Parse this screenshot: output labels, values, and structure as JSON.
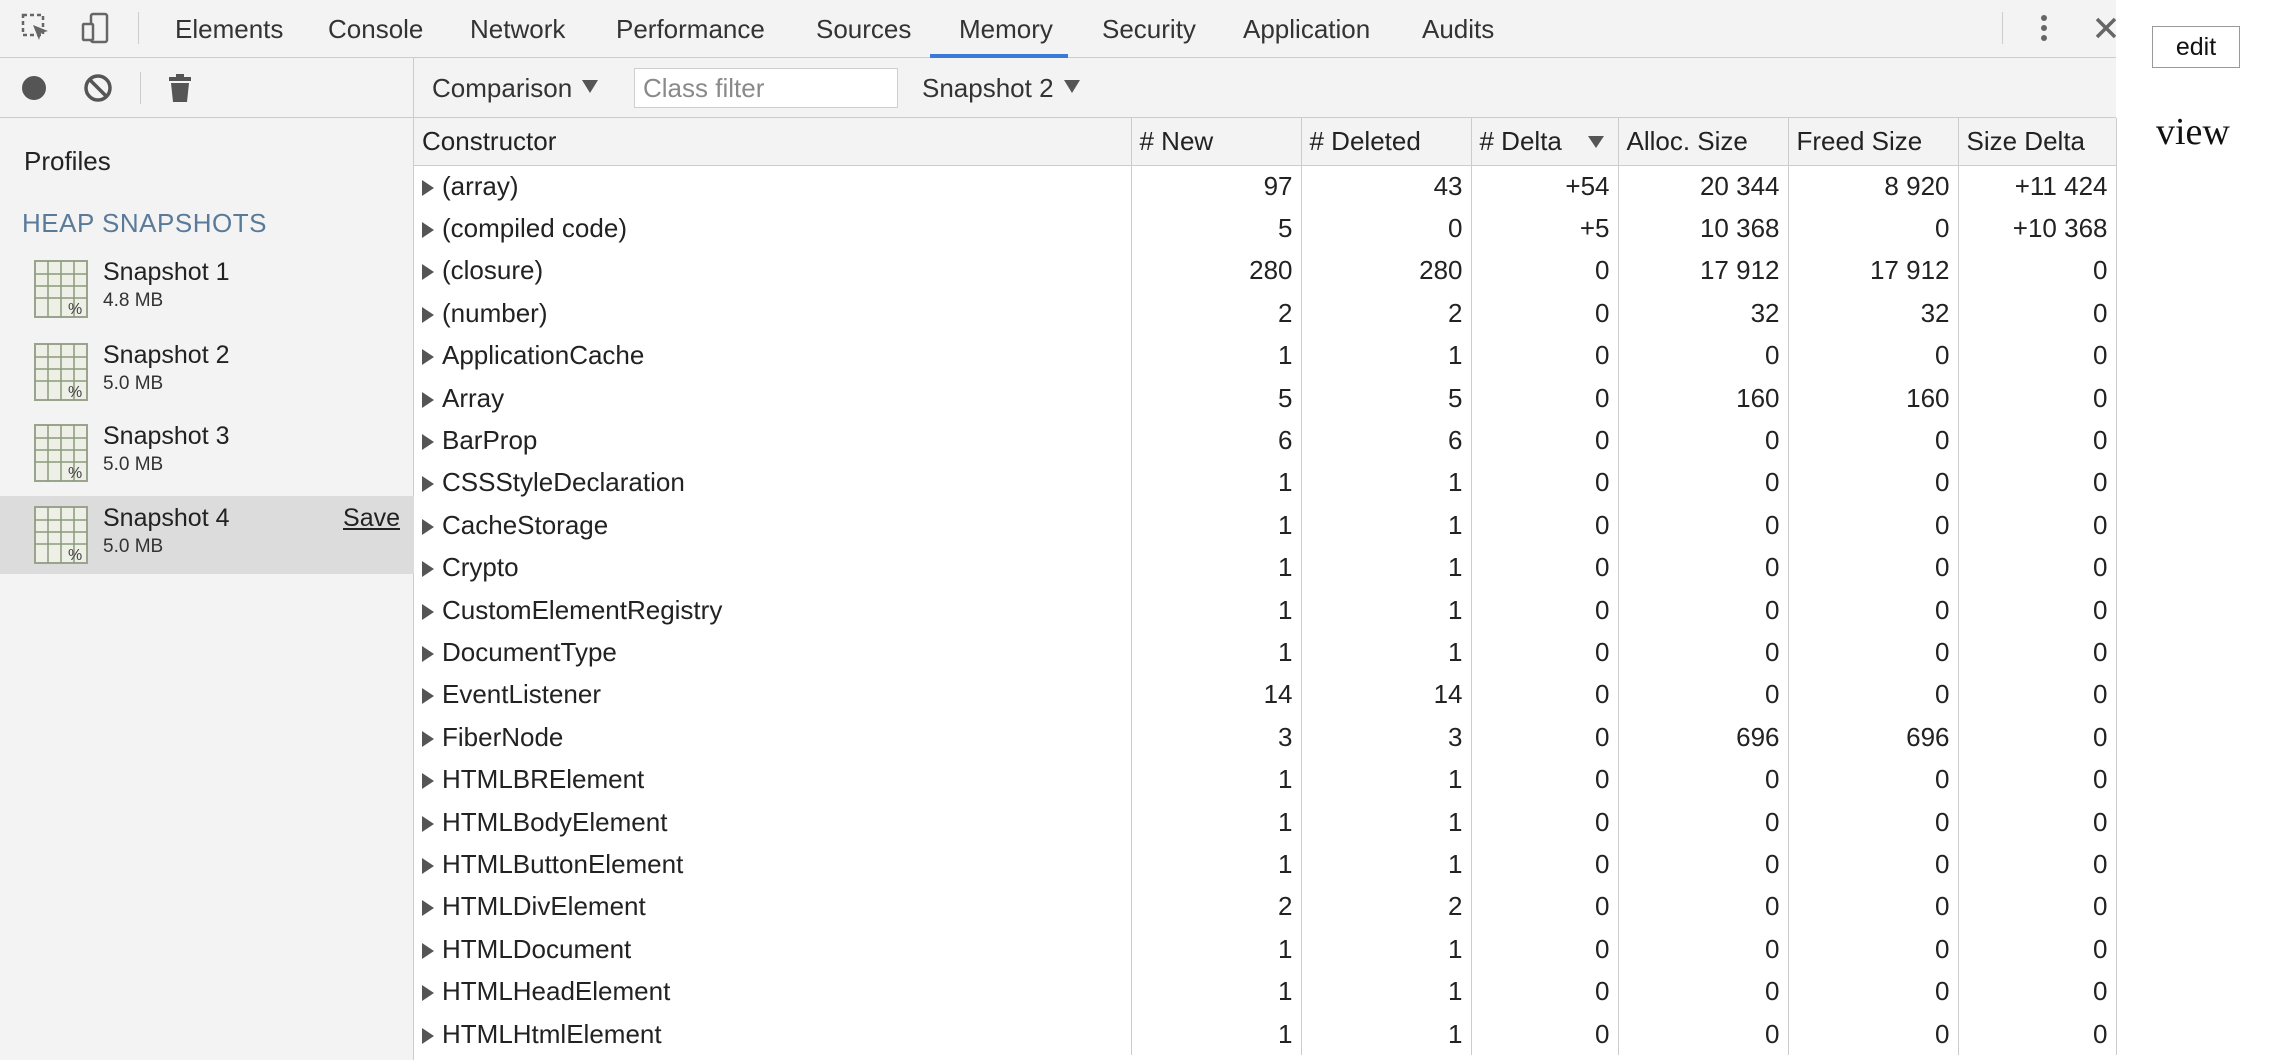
{
  "devtools": {
    "tabs": [
      {
        "label": "Elements"
      },
      {
        "label": "Console"
      },
      {
        "label": "Network"
      },
      {
        "label": "Performance"
      },
      {
        "label": "Sources"
      },
      {
        "label": "Memory",
        "active": true
      },
      {
        "label": "Security"
      },
      {
        "label": "Application"
      },
      {
        "label": "Audits"
      }
    ],
    "icons": [
      "inspect-icon",
      "device-toolbar-icon",
      "more-menu-icon",
      "close-icon"
    ],
    "accent": "#3879d9"
  },
  "sidebar": {
    "profiles_label": "Profiles",
    "heap_section_label": "HEAP SNAPSHOTS",
    "toolbar_icons": [
      "record-icon",
      "clear-icon",
      "trash-icon"
    ],
    "snapshots": [
      {
        "name": "Snapshot 1",
        "size": "4.8 MB"
      },
      {
        "name": "Snapshot 2",
        "size": "5.0 MB"
      },
      {
        "name": "Snapshot 3",
        "size": "5.0 MB"
      },
      {
        "name": "Snapshot 4",
        "size": "5.0 MB",
        "selected": true,
        "action": "Save"
      }
    ]
  },
  "toolbar": {
    "view_mode": "Comparison",
    "class_filter_placeholder": "Class filter",
    "base_snapshot": "Snapshot 2"
  },
  "table": {
    "columns": [
      "Constructor",
      "# New",
      "# Deleted",
      "# Delta",
      "Alloc. Size",
      "Freed Size",
      "Size Delta"
    ],
    "sorted_column": "# Delta",
    "rows": [
      {
        "name": "(array)",
        "new": "97",
        "deleted": "43",
        "delta": "+54",
        "alloc": "20 344",
        "freed": "8 920",
        "size_delta": "+11 424"
      },
      {
        "name": "(compiled code)",
        "new": "5",
        "deleted": "0",
        "delta": "+5",
        "alloc": "10 368",
        "freed": "0",
        "size_delta": "+10 368"
      },
      {
        "name": "(closure)",
        "new": "280",
        "deleted": "280",
        "delta": "0",
        "alloc": "17 912",
        "freed": "17 912",
        "size_delta": "0"
      },
      {
        "name": "(number)",
        "new": "2",
        "deleted": "2",
        "delta": "0",
        "alloc": "32",
        "freed": "32",
        "size_delta": "0"
      },
      {
        "name": "ApplicationCache",
        "new": "1",
        "deleted": "1",
        "delta": "0",
        "alloc": "0",
        "freed": "0",
        "size_delta": "0"
      },
      {
        "name": "Array",
        "new": "5",
        "deleted": "5",
        "delta": "0",
        "alloc": "160",
        "freed": "160",
        "size_delta": "0"
      },
      {
        "name": "BarProp",
        "new": "6",
        "deleted": "6",
        "delta": "0",
        "alloc": "0",
        "freed": "0",
        "size_delta": "0"
      },
      {
        "name": "CSSStyleDeclaration",
        "new": "1",
        "deleted": "1",
        "delta": "0",
        "alloc": "0",
        "freed": "0",
        "size_delta": "0"
      },
      {
        "name": "CacheStorage",
        "new": "1",
        "deleted": "1",
        "delta": "0",
        "alloc": "0",
        "freed": "0",
        "size_delta": "0"
      },
      {
        "name": "Crypto",
        "new": "1",
        "deleted": "1",
        "delta": "0",
        "alloc": "0",
        "freed": "0",
        "size_delta": "0"
      },
      {
        "name": "CustomElementRegistry",
        "new": "1",
        "deleted": "1",
        "delta": "0",
        "alloc": "0",
        "freed": "0",
        "size_delta": "0"
      },
      {
        "name": "DocumentType",
        "new": "1",
        "deleted": "1",
        "delta": "0",
        "alloc": "0",
        "freed": "0",
        "size_delta": "0"
      },
      {
        "name": "EventListener",
        "new": "14",
        "deleted": "14",
        "delta": "0",
        "alloc": "0",
        "freed": "0",
        "size_delta": "0"
      },
      {
        "name": "FiberNode",
        "new": "3",
        "deleted": "3",
        "delta": "0",
        "alloc": "696",
        "freed": "696",
        "size_delta": "0"
      },
      {
        "name": "HTMLBRElement",
        "new": "1",
        "deleted": "1",
        "delta": "0",
        "alloc": "0",
        "freed": "0",
        "size_delta": "0"
      },
      {
        "name": "HTMLBodyElement",
        "new": "1",
        "deleted": "1",
        "delta": "0",
        "alloc": "0",
        "freed": "0",
        "size_delta": "0"
      },
      {
        "name": "HTMLButtonElement",
        "new": "1",
        "deleted": "1",
        "delta": "0",
        "alloc": "0",
        "freed": "0",
        "size_delta": "0"
      },
      {
        "name": "HTMLDivElement",
        "new": "2",
        "deleted": "2",
        "delta": "0",
        "alloc": "0",
        "freed": "0",
        "size_delta": "0"
      },
      {
        "name": "HTMLDocument",
        "new": "1",
        "deleted": "1",
        "delta": "0",
        "alloc": "0",
        "freed": "0",
        "size_delta": "0"
      },
      {
        "name": "HTMLHeadElement",
        "new": "1",
        "deleted": "1",
        "delta": "0",
        "alloc": "0",
        "freed": "0",
        "size_delta": "0"
      },
      {
        "name": "HTMLHtmlElement",
        "new": "1",
        "deleted": "1",
        "delta": "0",
        "alloc": "0",
        "freed": "0",
        "size_delta": "0"
      }
    ]
  },
  "page": {
    "edit_label": "edit",
    "view_label": "view"
  }
}
